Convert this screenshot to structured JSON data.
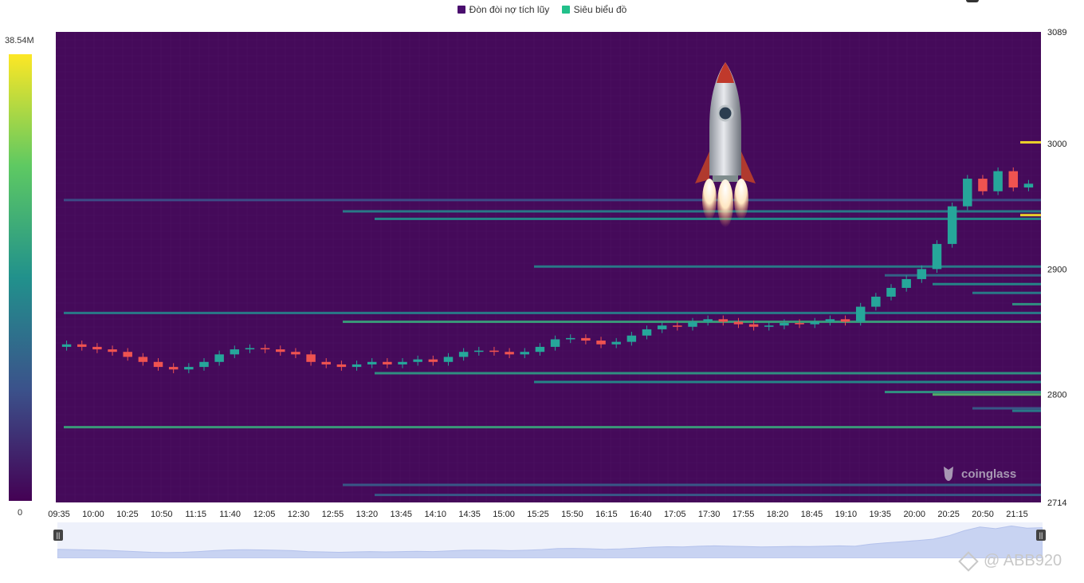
{
  "legend": {
    "items": [
      {
        "label": "Đòn đòi nợ tích lũy",
        "color": "#4a0e6e"
      },
      {
        "label": "Siêu biểu đồ",
        "color": "#22c08a"
      }
    ]
  },
  "colorbar": {
    "max_label": "38.54M",
    "min_label": "0"
  },
  "watermark": {
    "text": "coinglass"
  },
  "credit": {
    "text": "@ ABB920"
  },
  "slider": {
    "left_handle": "||",
    "right_handle": "||"
  },
  "colors": {
    "background": "#450a5a",
    "up_candle": "#26a69a",
    "down_candle": "#ef5350",
    "heat_low": "#3b528b",
    "heat_mid": "#21918c",
    "heat_high": "#fde725"
  },
  "chart_data": {
    "type": "heatmap",
    "title": "",
    "xlabel": "",
    "ylabel": "",
    "x_ticks": [
      "09:35",
      "10:00",
      "10:25",
      "10:50",
      "11:15",
      "11:40",
      "12:05",
      "12:30",
      "12:55",
      "13:20",
      "13:45",
      "14:10",
      "14:35",
      "15:00",
      "15:25",
      "15:50",
      "16:15",
      "16:40",
      "17:05",
      "17:30",
      "17:55",
      "18:20",
      "18:45",
      "19:10",
      "19:35",
      "20:00",
      "20:25",
      "20:50",
      "21:15"
    ],
    "y_ticks": [
      3089,
      3000,
      2900,
      2800,
      2714
    ],
    "ylim": [
      2714,
      3089
    ],
    "colorbar_range": [
      0,
      38540000
    ],
    "price_series": [
      2840,
      2838,
      2836,
      2834,
      2830,
      2826,
      2822,
      2820,
      2822,
      2826,
      2832,
      2836,
      2837,
      2836,
      2834,
      2832,
      2826,
      2824,
      2822,
      2824,
      2826,
      2824,
      2826,
      2828,
      2826,
      2830,
      2834,
      2835,
      2834,
      2832,
      2834,
      2838,
      2844,
      2845,
      2843,
      2840,
      2842,
      2847,
      2852,
      2855,
      2854,
      2858,
      2860,
      2858,
      2856,
      2854,
      2855,
      2857,
      2856,
      2858,
      2860,
      2858,
      2870,
      2878,
      2885,
      2892,
      2900,
      2920,
      2950,
      2972,
      2962,
      2978,
      2965,
      2968
    ],
    "liquidity_levels": [
      {
        "price": 2955,
        "intensity": 0.25
      },
      {
        "price": 2946,
        "intensity": 0.45
      },
      {
        "price": 2940,
        "intensity": 0.5
      },
      {
        "price": 2902,
        "intensity": 0.45
      },
      {
        "price": 2895,
        "intensity": 0.35
      },
      {
        "price": 2888,
        "intensity": 0.5
      },
      {
        "price": 2881,
        "intensity": 0.45
      },
      {
        "price": 2872,
        "intensity": 0.55
      },
      {
        "price": 2865,
        "intensity": 0.45
      },
      {
        "price": 2858,
        "intensity": 0.6
      },
      {
        "price": 2817,
        "intensity": 0.55
      },
      {
        "price": 2810,
        "intensity": 0.5
      },
      {
        "price": 2802,
        "intensity": 0.55
      },
      {
        "price": 2800,
        "intensity": 0.7
      },
      {
        "price": 2789,
        "intensity": 0.3
      },
      {
        "price": 2787,
        "intensity": 0.45
      },
      {
        "price": 2774,
        "intensity": 0.6
      },
      {
        "price": 2728,
        "intensity": 0.3
      },
      {
        "price": 2720,
        "intensity": 0.3
      },
      {
        "price": 3001,
        "intensity": 1.0
      },
      {
        "price": 2943,
        "intensity": 1.0
      }
    ]
  }
}
